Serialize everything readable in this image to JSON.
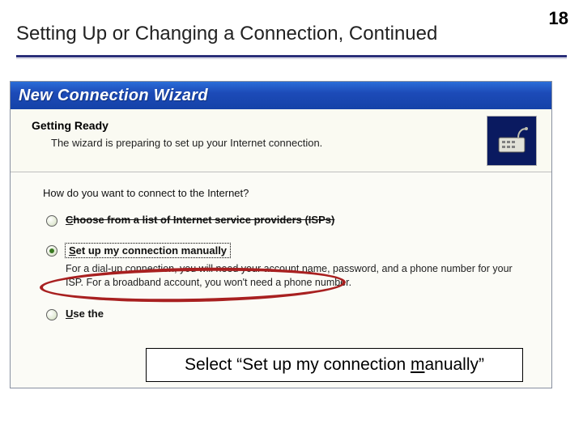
{
  "slide": {
    "title": "Setting Up or Changing a Connection, Continued",
    "page_number": "18"
  },
  "wizard": {
    "titlebar": "New Connection Wizard",
    "banner": {
      "heading": "Getting Ready",
      "subtext": "The wizard is preparing to set up your Internet connection.",
      "icon_name": "modem-device-icon"
    },
    "prompt": "How do you want to connect to the Internet?",
    "options": [
      {
        "label_prefix": "C",
        "label_rest": "hoose from a list of Internet service providers (ISPs)",
        "selected": false
      },
      {
        "label_prefix": "S",
        "label_rest": "et up my connection manually",
        "selected": true,
        "desc": "For a dial-up connection, you will need your account name, password, and a phone number for your ISP. For a broadband account, you won't need a phone number."
      },
      {
        "label_prefix": "U",
        "label_rest": "se the",
        "selected": false
      }
    ]
  },
  "callout": {
    "prefix": "Select “Set up my connection ",
    "u": "m",
    "suffix": "anually”"
  }
}
